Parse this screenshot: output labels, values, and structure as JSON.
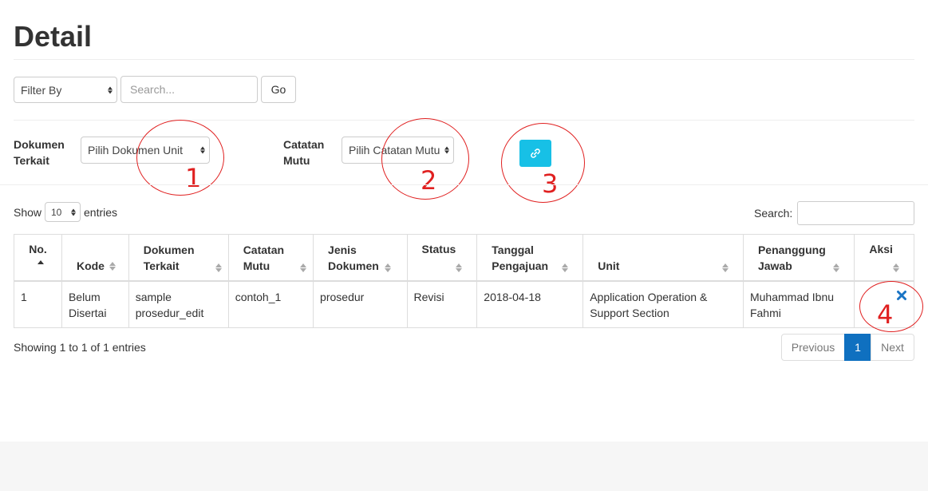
{
  "page": {
    "title": "Detail"
  },
  "filter": {
    "select_value": "Filter By",
    "search_placeholder": "Search...",
    "go_label": "Go"
  },
  "linker": {
    "dokumen_label_line1": "Dokumen",
    "dokumen_label_line2": "Terkait",
    "dokumen_select_value": "Pilih Dokumen Unit",
    "catatan_label_line1": "Catatan",
    "catatan_label_line2": "Mutu",
    "catatan_select_value": "Pilih Catatan Mutu",
    "link_button_icon": "link-icon",
    "accent_color": "#17c0e6"
  },
  "annotations": [
    "1",
    "2",
    "3",
    "4"
  ],
  "table_controls": {
    "show_label": "Show",
    "entries_value": "10",
    "entries_label": "entries",
    "search_label": "Search:"
  },
  "table": {
    "headers": [
      {
        "line1": "No.",
        "line2": ""
      },
      {
        "line1": "Kode",
        "line2": ""
      },
      {
        "line1": "Dokumen",
        "line2": "Terkait"
      },
      {
        "line1": "Catatan",
        "line2": "Mutu"
      },
      {
        "line1": "Jenis",
        "line2": "Dokumen"
      },
      {
        "line1": "Status",
        "line2": ""
      },
      {
        "line1": "Tanggal",
        "line2": "Pengajuan"
      },
      {
        "line1": "Unit",
        "line2": ""
      },
      {
        "line1": "Penanggung",
        "line2": "Jawab"
      },
      {
        "line1": "Aksi",
        "line2": ""
      }
    ],
    "rows": [
      {
        "no": "1",
        "kode": "Belum Disertai",
        "dokumen_terkait": "sample prosedur_edit",
        "catatan_mutu": "contoh_1",
        "jenis_dokumen": "prosedur",
        "status": "Revisi",
        "tanggal_pengajuan": "2018-04-18",
        "unit": "Application Operation & Support Section",
        "penanggung_jawab": "Muhammad Ibnu Fahmi",
        "aksi_icon": "close-icon"
      }
    ]
  },
  "footer": {
    "info": "Showing 1 to 1 of 1 entries",
    "previous_label": "Previous",
    "current_page": "1",
    "next_label": "Next",
    "active_color": "#0f70c0"
  }
}
